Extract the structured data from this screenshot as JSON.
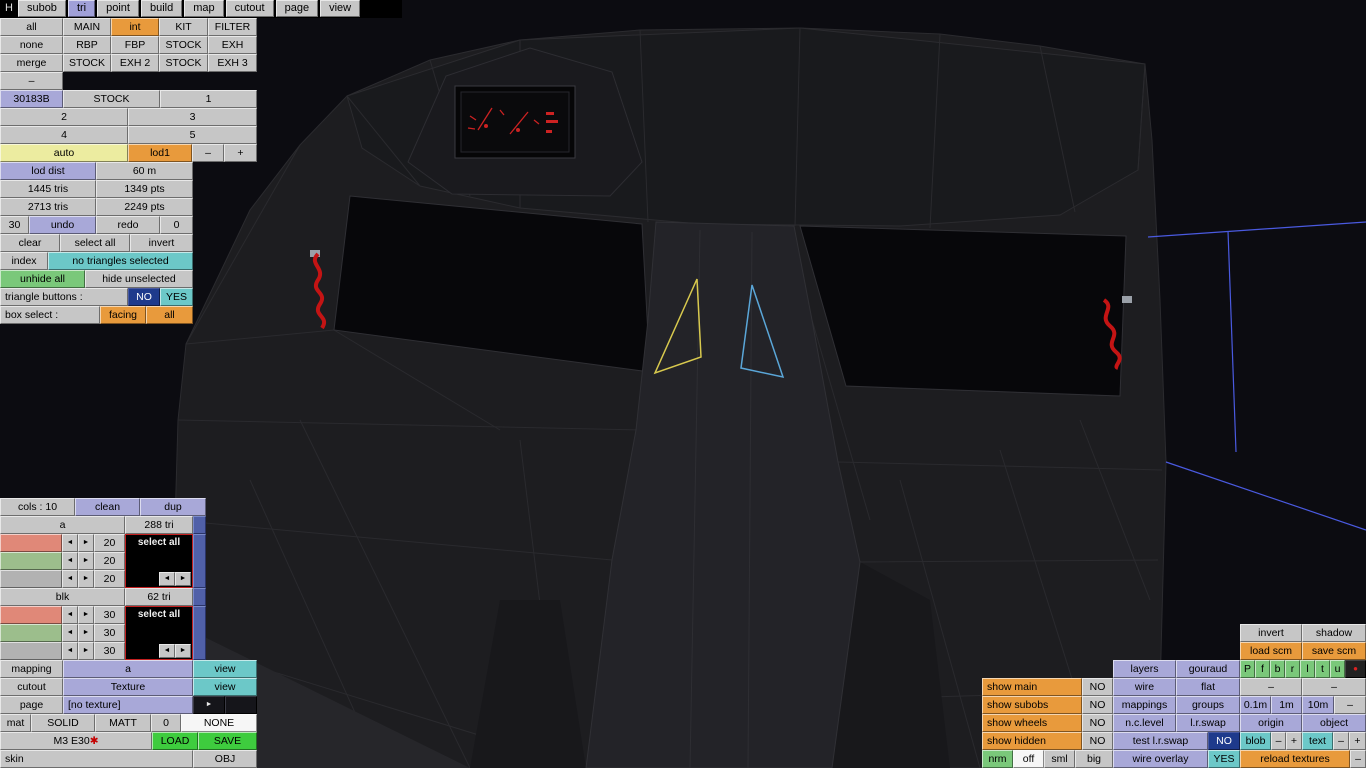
{
  "colors": {
    "orange": "#e89a3c",
    "periwinkle": "#a8a8d8",
    "cyan": "#6cc8c8",
    "green": "#7ac87a",
    "bright_green": "#3ecc3e",
    "pale_yellow": "#ececa0",
    "navy": "#1e3a8c",
    "selection_yellow": "#d8c94e",
    "selection_cyan": "#5aa6d8",
    "belt_red": "#c41414",
    "grid_blue": "#4a5ae0"
  },
  "menubar": {
    "items": [
      "H",
      "subob",
      "tri",
      "point",
      "build",
      "map",
      "cutout",
      "page",
      "view"
    ]
  },
  "filters": {
    "r1": [
      "all",
      "MAIN",
      "int",
      "KIT",
      "FILTER"
    ],
    "r2": [
      "none",
      "RBP",
      "FBP",
      "STOCK",
      "EXH"
    ],
    "r3": [
      "merge",
      "STOCK",
      "EXH 2",
      "STOCK",
      "EXH 3"
    ],
    "r4": [
      "–"
    ],
    "r5": [
      "30183B",
      "STOCK",
      "1"
    ],
    "r6": [
      "2",
      "3"
    ],
    "r7": [
      "4",
      "5"
    ],
    "r8": [
      "auto",
      "lod1",
      "–",
      "+"
    ]
  },
  "lod": {
    "dist_label": "lod dist",
    "dist_value": "60 m",
    "tris_lod": "1445 tris",
    "pts_lod": "1349 pts",
    "tris_total": "2713 tris",
    "pts_total": "2249 pts"
  },
  "edit": {
    "undo_steps": "30",
    "undo": "undo",
    "redo": "redo",
    "redo_steps": "0",
    "clear": "clear",
    "select_all": "select all",
    "invert": "invert",
    "index": "index",
    "selection_status": "no triangles selected",
    "unhide_all": "unhide all",
    "hide_unselected": "hide unselected",
    "triangle_buttons_label": "triangle buttons :",
    "no": "NO",
    "yes": "YES",
    "box_select_label": "box select :",
    "facing": "facing",
    "all": "all"
  },
  "materials": {
    "cols": "cols : 10",
    "clean": "clean",
    "dup": "dup",
    "arrow_left": "◄",
    "arrow_right": "►",
    "group_a": {
      "name": "a",
      "tris": "288 tri",
      "values": [
        "20",
        "20",
        "20"
      ],
      "select_all": "select all"
    },
    "group_blk": {
      "name": "blk",
      "tris": "62 tri",
      "values": [
        "30",
        "30",
        "30"
      ],
      "select_all": "select all"
    },
    "mapping_label": "mapping",
    "mapping_value": "a",
    "view": "view",
    "cutout_label": "cutout",
    "cutout_value": "Texture",
    "page_label": "page",
    "page_value": "[no texture]",
    "page_next": "►",
    "mat_label": "mat",
    "solid": "SOLID",
    "matt": "MATT",
    "zero": "0",
    "none": "NONE",
    "car_name": "M3 E30",
    "car_mark": "✱",
    "load": "LOAD",
    "save": "SAVE",
    "skin": "skin",
    "obj": "OBJ"
  },
  "scm": {
    "invert": "invert",
    "shadow": "shadow",
    "load_scm": "load scm",
    "save_scm": "save scm",
    "quick": [
      "P",
      "f",
      "b",
      "r",
      "l",
      "t",
      "u"
    ],
    "record_dot": "●"
  },
  "display": {
    "layers": "layers",
    "gouraud": "gouraud",
    "show_main": "show main",
    "main_no": "NO",
    "wire": "wire",
    "flat": "flat",
    "main_d1": "–",
    "main_d2": "–",
    "show_subobs": "show subobs",
    "subobs_no": "NO",
    "mappings": "mappings",
    "groups": "groups",
    "g01": "0.1m",
    "g1": "1m",
    "g10": "10m",
    "gd": "–",
    "show_wheels": "show wheels",
    "wheels_no": "NO",
    "nclevel": "n.c.level",
    "lrswap": "l.r.swap",
    "origin": "origin",
    "object": "object",
    "show_hidden": "show hidden",
    "hidden_no": "NO",
    "test_lrswap": "test l.r.swap",
    "test_no": "NO",
    "blob": "blob",
    "blob_minus": "–",
    "blob_plus": "+",
    "text": "text",
    "text_minus": "–",
    "text_plus": "+",
    "nrm": "nrm",
    "off": "off",
    "sml": "sml",
    "big": "big",
    "wire_overlay": "wire overlay",
    "overlay_yes": "YES",
    "reload_textures": "reload textures",
    "bottom_minus": "–"
  }
}
